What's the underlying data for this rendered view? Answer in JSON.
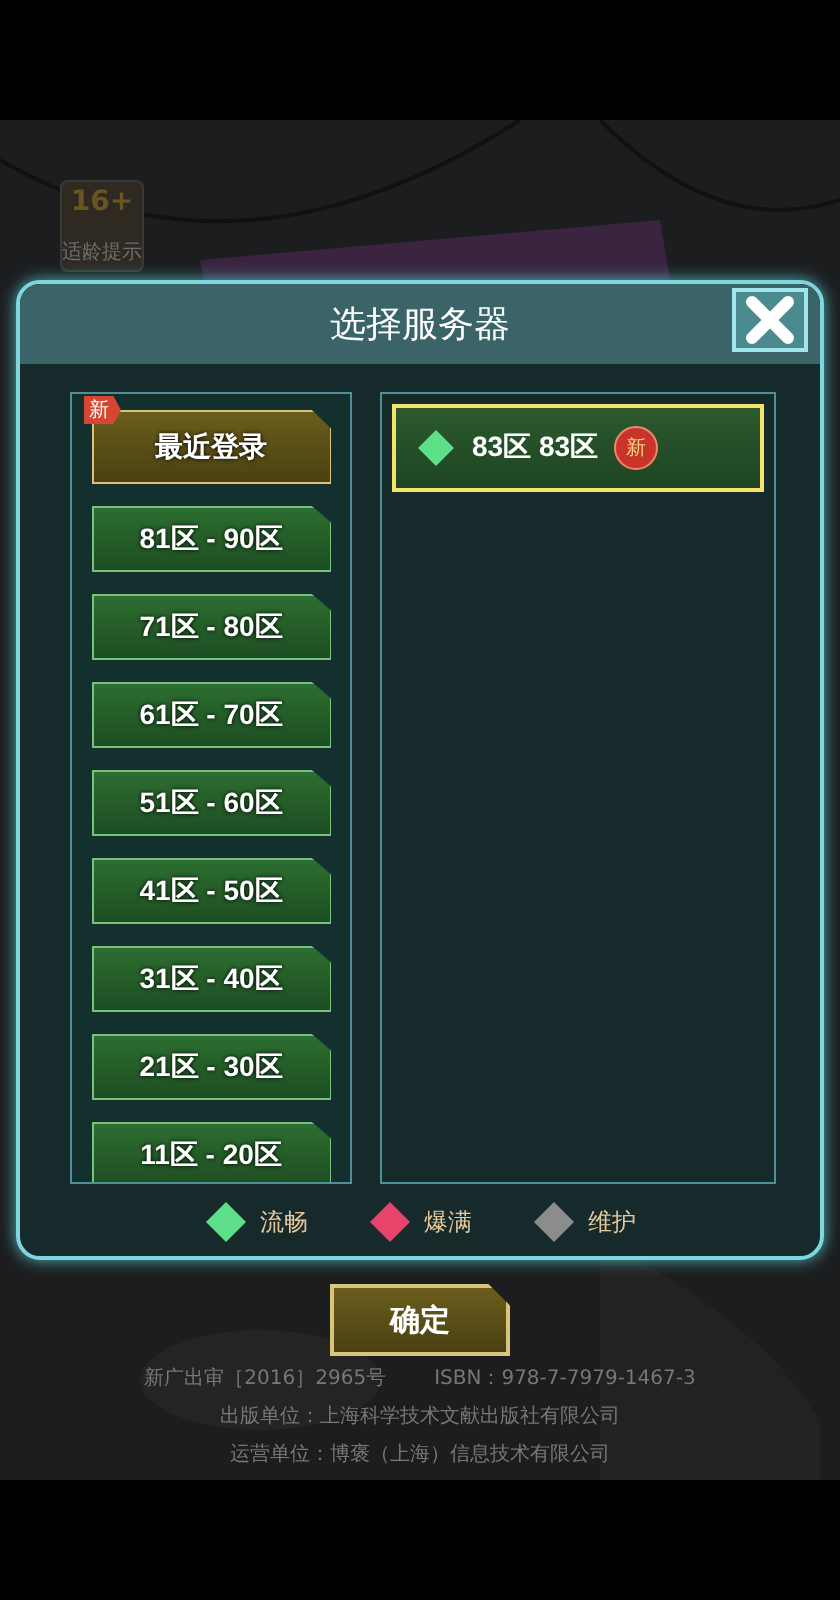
{
  "age_badge": {
    "rating": "16+",
    "label": "适龄提示"
  },
  "background_text": [
    [
      "新广出审［2016］2965号",
      "ISBN：978-7-7979-1467-3"
    ],
    [
      "出版单位：上海科学技术文献出版社有限公司"
    ],
    [
      "运营单位：博褒（上海）信息技术有限公司"
    ]
  ],
  "dialog": {
    "title": "选择服务器",
    "groups": [
      {
        "kind": "recent",
        "label": "最近登录",
        "badge": "新",
        "selected": true
      },
      {
        "kind": "range",
        "label": "81区 - 90区",
        "selected": false
      },
      {
        "kind": "range",
        "label": "71区 - 80区",
        "selected": false
      },
      {
        "kind": "range",
        "label": "61区 - 70区",
        "selected": false
      },
      {
        "kind": "range",
        "label": "51区 - 60区",
        "selected": false
      },
      {
        "kind": "range",
        "label": "41区 - 50区",
        "selected": false
      },
      {
        "kind": "range",
        "label": "31区 - 40区",
        "selected": false
      },
      {
        "kind": "range",
        "label": "21区 - 30区",
        "selected": false
      },
      {
        "kind": "range",
        "label": "11区 - 20区",
        "selected": false
      }
    ],
    "servers": [
      {
        "name": "83区 83区",
        "badge": "新",
        "color": "#5ee08a",
        "selected": true
      }
    ],
    "legend": [
      {
        "label": "流畅",
        "color": "#5ee08a"
      },
      {
        "label": "爆满",
        "color": "#e8436a"
      },
      {
        "label": "维护",
        "color": "#8c8c8c"
      }
    ],
    "confirm_button": "确定"
  }
}
